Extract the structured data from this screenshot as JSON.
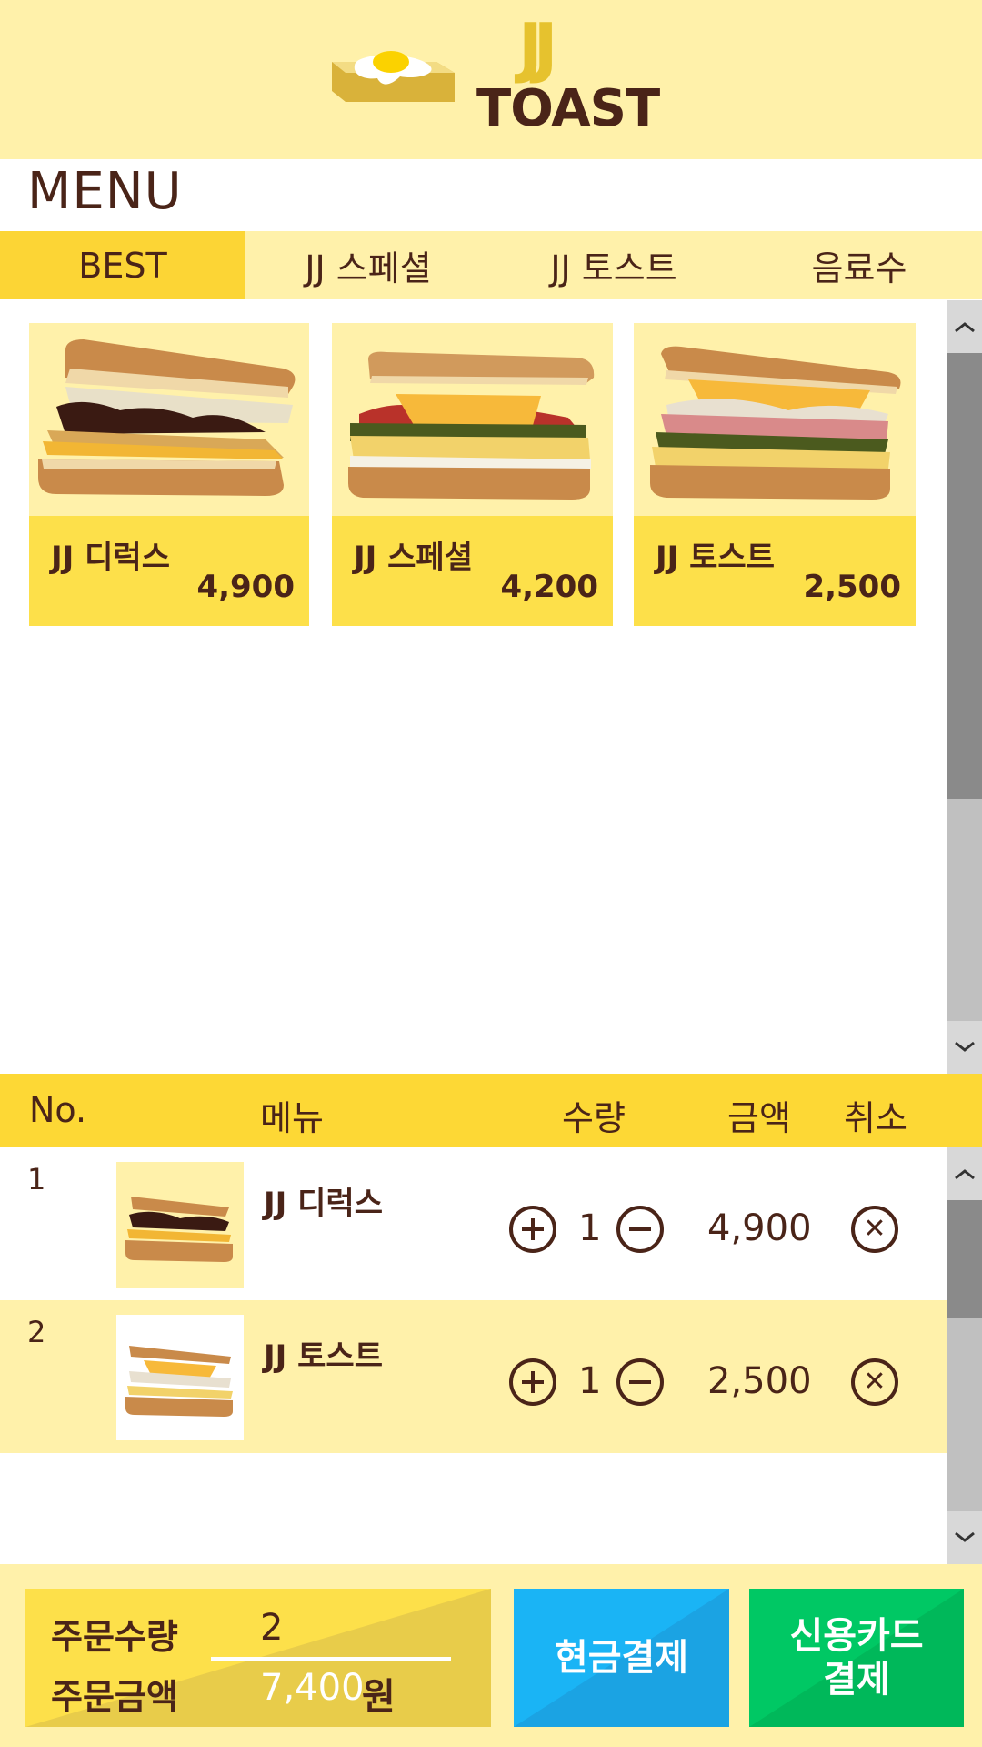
{
  "header": {
    "logo_mark": "JJ",
    "logo_text": "TOAST"
  },
  "menu_title": "MENU",
  "tabs": [
    {
      "label": "BEST",
      "active": true
    },
    {
      "label": "JJ 스페셜",
      "active": false
    },
    {
      "label": "JJ 토스트",
      "active": false
    },
    {
      "label": "음료수",
      "active": false
    }
  ],
  "products": [
    {
      "name": "JJ 디럭스",
      "price": "4,900",
      "image": "deluxe-sandwich"
    },
    {
      "name": "JJ 스페셜",
      "price": "4,200",
      "image": "special-sandwich"
    },
    {
      "name": "JJ 토스트",
      "price": "2,500",
      "image": "toast-sandwich"
    }
  ],
  "order_table": {
    "headers": {
      "no": "No.",
      "menu": "메뉴",
      "qty": "수량",
      "amount": "금액",
      "cancel": "취소"
    },
    "rows": [
      {
        "no": "1",
        "name": "JJ 디럭스",
        "qty": "1",
        "amount": "4,900"
      },
      {
        "no": "2",
        "name": "JJ 토스트",
        "qty": "1",
        "amount": "2,500"
      }
    ]
  },
  "summary": {
    "qty_label": "주문수량",
    "qty_value": "2",
    "amount_label": "주문금액",
    "amount_value": "7,400",
    "currency": "원"
  },
  "buttons": {
    "cash": "현금결제",
    "card_line1": "신용카드",
    "card_line2": "결제"
  },
  "colors": {
    "background_light": "#fff1aa",
    "accent_yellow": "#fdd835",
    "text_brown": "#4a2418",
    "cash_blue": "#1aaaf0",
    "card_green": "#00c060"
  }
}
